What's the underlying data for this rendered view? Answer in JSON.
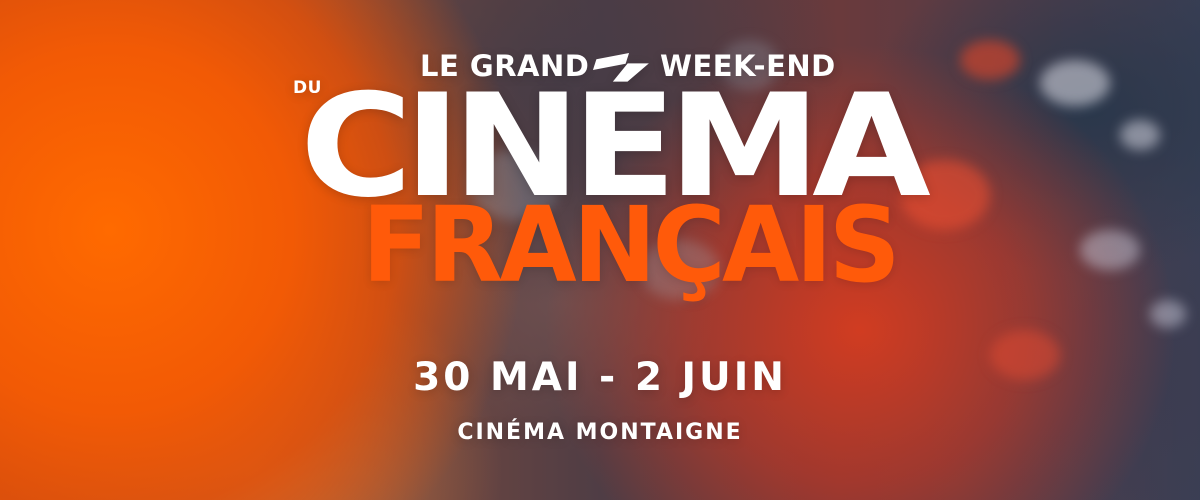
{
  "event": {
    "line_top_left": "LE GRAND",
    "line_top_right": "WEEK-END",
    "connector": "DU",
    "title_main": "CINÉMA",
    "title_sub": "FRANÇAIS",
    "dates": "30 MAI - 2 JUIN",
    "venue": "CINÉMA MONTAIGNE"
  },
  "colors": {
    "accent": "#ff5a0a",
    "text": "#ffffff"
  }
}
